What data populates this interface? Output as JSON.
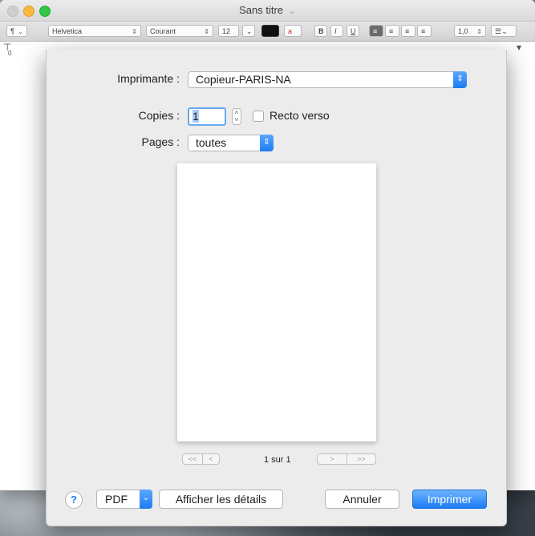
{
  "window": {
    "title": "Sans titre",
    "title_chevron": "⌄"
  },
  "toolbar": {
    "paragraph_style": "¶",
    "font_family": "Helvetica",
    "font_style": "Courant",
    "font_size": "12",
    "line_spacing": "1,0",
    "bold": "B",
    "italic": "I",
    "underline": "U"
  },
  "ruler": {
    "zero_label": "0"
  },
  "print": {
    "printer_label": "Imprimante :",
    "printer_value": "Copieur-PARIS-NA",
    "copies_label": "Copies :",
    "copies_value": "1",
    "duplex_label": "Recto verso",
    "pages_label": "Pages :",
    "pages_value": "toutes",
    "nav_first": "<<",
    "nav_prev": "<",
    "nav_next": ">",
    "nav_last": ">>",
    "page_info": "1 sur 1",
    "help": "?",
    "pdf": "PDF",
    "details": "Afficher les détails",
    "cancel": "Annuler",
    "print": "Imprimer"
  },
  "colors": {
    "accent": "#1c7cf4",
    "sheet_bg": "#ececec"
  }
}
